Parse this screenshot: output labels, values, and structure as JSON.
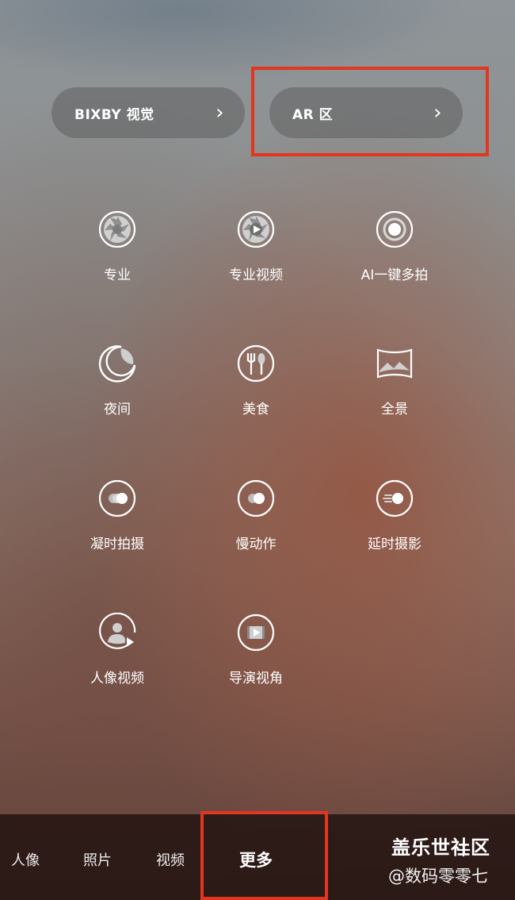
{
  "top": {
    "bixby_label": "BIXBY 视觉",
    "ar_label": "AR 区"
  },
  "modes": [
    {
      "label": "专业",
      "icon": "aperture-icon"
    },
    {
      "label": "专业视频",
      "icon": "aperture-play-icon"
    },
    {
      "label": "AI一键多拍",
      "icon": "ring-dot-icon"
    },
    {
      "label": "夜间",
      "icon": "moon-icon"
    },
    {
      "label": "美食",
      "icon": "fork-spoon-icon"
    },
    {
      "label": "全景",
      "icon": "panorama-icon"
    },
    {
      "label": "凝时拍摄",
      "icon": "hyperlapse-icon"
    },
    {
      "label": "慢动作",
      "icon": "slow-motion-icon"
    },
    {
      "label": "延时摄影",
      "icon": "timelapse-icon"
    },
    {
      "label": "人像视频",
      "icon": "portrait-video-icon"
    },
    {
      "label": "导演视角",
      "icon": "director-view-icon"
    }
  ],
  "bottom_tabs": {
    "portrait": "人像",
    "photo": "照片",
    "video": "视频",
    "more": "更多"
  },
  "watermark": {
    "line1": "盖乐世社区",
    "line2": "@数码零零七"
  },
  "colors": {
    "highlight_box": "#e2361f",
    "pill_bg": "rgba(95,95,95,0.55)"
  }
}
